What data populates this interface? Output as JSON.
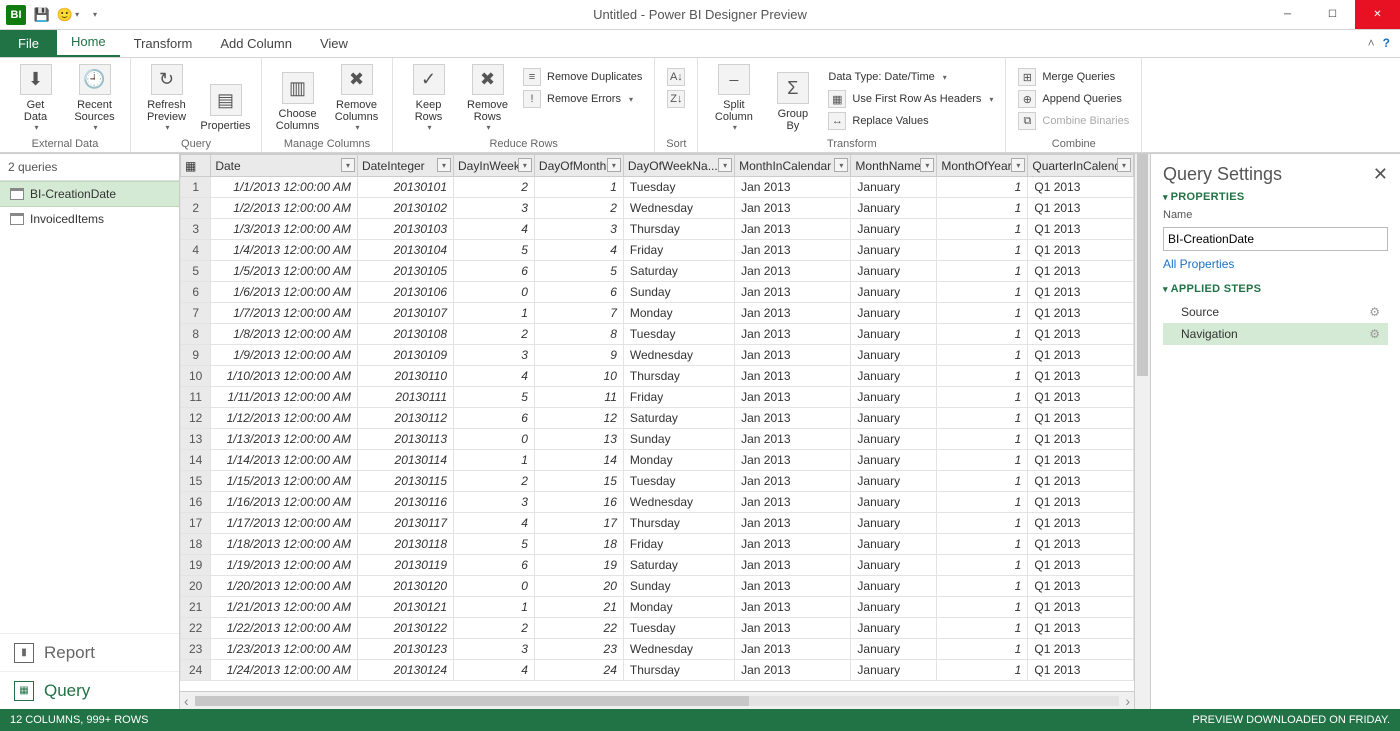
{
  "title": "Untitled - Power BI Designer Preview",
  "tabs": {
    "file": "File",
    "home": "Home",
    "transform": "Transform",
    "addcolumn": "Add Column",
    "view": "View"
  },
  "ribbon": {
    "external_data": {
      "label": "External Data",
      "get_data": "Get\nData",
      "recent_sources": "Recent\nSources"
    },
    "query": {
      "label": "Query",
      "refresh": "Refresh\nPreview",
      "properties": "Properties"
    },
    "manage_columns": {
      "label": "Manage Columns",
      "choose": "Choose\nColumns",
      "remove": "Remove\nColumns"
    },
    "reduce_rows": {
      "label": "Reduce Rows",
      "keep": "Keep\nRows",
      "remove": "Remove\nRows",
      "remove_dup": "Remove Duplicates",
      "remove_err": "Remove Errors"
    },
    "sort": {
      "label": "Sort"
    },
    "transform": {
      "label": "Transform",
      "split": "Split\nColumn",
      "group": "Group\nBy",
      "data_type": "Data Type: Date/Time",
      "first_row": "Use First Row As Headers",
      "replace": "Replace Values"
    },
    "combine": {
      "label": "Combine",
      "merge": "Merge Queries",
      "append": "Append Queries",
      "binaries": "Combine Binaries"
    }
  },
  "queries_panel": {
    "count_label": "2 queries",
    "items": [
      {
        "name": "BI-CreationDate",
        "selected": true
      },
      {
        "name": "InvoicedItems",
        "selected": false
      }
    ],
    "nav_report": "Report",
    "nav_query": "Query"
  },
  "columns": [
    {
      "key": "Date",
      "label": "Date",
      "cls": "col-date"
    },
    {
      "key": "DateInteger",
      "label": "DateInteger",
      "cls": "col-int"
    },
    {
      "key": "DayInWeek",
      "label": "DayInWeek",
      "cls": "col-diw"
    },
    {
      "key": "DayOfMonth",
      "label": "DayOfMonth",
      "cls": "col-dom"
    },
    {
      "key": "DayOfWeekName",
      "label": "DayOfWeekNa...",
      "cls": "col-down"
    },
    {
      "key": "MonthInCalendar",
      "label": "MonthInCalendar",
      "cls": "col-mic"
    },
    {
      "key": "MonthName",
      "label": "MonthName",
      "cls": "col-mname"
    },
    {
      "key": "MonthOfYear",
      "label": "MonthOfYear",
      "cls": "col-moy"
    },
    {
      "key": "QuarterInCalendar",
      "label": "QuarterInCalenda",
      "cls": "col-qic"
    }
  ],
  "rows": [
    {
      "n": 1,
      "Date": "1/1/2013 12:00:00 AM",
      "DateInteger": "20130101",
      "DayInWeek": "2",
      "DayOfMonth": "1",
      "DayOfWeekName": "Tuesday",
      "MonthInCalendar": "Jan 2013",
      "MonthName": "January",
      "MonthOfYear": "1",
      "QuarterInCalendar": "Q1 2013"
    },
    {
      "n": 2,
      "Date": "1/2/2013 12:00:00 AM",
      "DateInteger": "20130102",
      "DayInWeek": "3",
      "DayOfMonth": "2",
      "DayOfWeekName": "Wednesday",
      "MonthInCalendar": "Jan 2013",
      "MonthName": "January",
      "MonthOfYear": "1",
      "QuarterInCalendar": "Q1 2013"
    },
    {
      "n": 3,
      "Date": "1/3/2013 12:00:00 AM",
      "DateInteger": "20130103",
      "DayInWeek": "4",
      "DayOfMonth": "3",
      "DayOfWeekName": "Thursday",
      "MonthInCalendar": "Jan 2013",
      "MonthName": "January",
      "MonthOfYear": "1",
      "QuarterInCalendar": "Q1 2013"
    },
    {
      "n": 4,
      "Date": "1/4/2013 12:00:00 AM",
      "DateInteger": "20130104",
      "DayInWeek": "5",
      "DayOfMonth": "4",
      "DayOfWeekName": "Friday",
      "MonthInCalendar": "Jan 2013",
      "MonthName": "January",
      "MonthOfYear": "1",
      "QuarterInCalendar": "Q1 2013"
    },
    {
      "n": 5,
      "Date": "1/5/2013 12:00:00 AM",
      "DateInteger": "20130105",
      "DayInWeek": "6",
      "DayOfMonth": "5",
      "DayOfWeekName": "Saturday",
      "MonthInCalendar": "Jan 2013",
      "MonthName": "January",
      "MonthOfYear": "1",
      "QuarterInCalendar": "Q1 2013"
    },
    {
      "n": 6,
      "Date": "1/6/2013 12:00:00 AM",
      "DateInteger": "20130106",
      "DayInWeek": "0",
      "DayOfMonth": "6",
      "DayOfWeekName": "Sunday",
      "MonthInCalendar": "Jan 2013",
      "MonthName": "January",
      "MonthOfYear": "1",
      "QuarterInCalendar": "Q1 2013"
    },
    {
      "n": 7,
      "Date": "1/7/2013 12:00:00 AM",
      "DateInteger": "20130107",
      "DayInWeek": "1",
      "DayOfMonth": "7",
      "DayOfWeekName": "Monday",
      "MonthInCalendar": "Jan 2013",
      "MonthName": "January",
      "MonthOfYear": "1",
      "QuarterInCalendar": "Q1 2013"
    },
    {
      "n": 8,
      "Date": "1/8/2013 12:00:00 AM",
      "DateInteger": "20130108",
      "DayInWeek": "2",
      "DayOfMonth": "8",
      "DayOfWeekName": "Tuesday",
      "MonthInCalendar": "Jan 2013",
      "MonthName": "January",
      "MonthOfYear": "1",
      "QuarterInCalendar": "Q1 2013"
    },
    {
      "n": 9,
      "Date": "1/9/2013 12:00:00 AM",
      "DateInteger": "20130109",
      "DayInWeek": "3",
      "DayOfMonth": "9",
      "DayOfWeekName": "Wednesday",
      "MonthInCalendar": "Jan 2013",
      "MonthName": "January",
      "MonthOfYear": "1",
      "QuarterInCalendar": "Q1 2013"
    },
    {
      "n": 10,
      "Date": "1/10/2013 12:00:00 AM",
      "DateInteger": "20130110",
      "DayInWeek": "4",
      "DayOfMonth": "10",
      "DayOfWeekName": "Thursday",
      "MonthInCalendar": "Jan 2013",
      "MonthName": "January",
      "MonthOfYear": "1",
      "QuarterInCalendar": "Q1 2013"
    },
    {
      "n": 11,
      "Date": "1/11/2013 12:00:00 AM",
      "DateInteger": "20130111",
      "DayInWeek": "5",
      "DayOfMonth": "11",
      "DayOfWeekName": "Friday",
      "MonthInCalendar": "Jan 2013",
      "MonthName": "January",
      "MonthOfYear": "1",
      "QuarterInCalendar": "Q1 2013"
    },
    {
      "n": 12,
      "Date": "1/12/2013 12:00:00 AM",
      "DateInteger": "20130112",
      "DayInWeek": "6",
      "DayOfMonth": "12",
      "DayOfWeekName": "Saturday",
      "MonthInCalendar": "Jan 2013",
      "MonthName": "January",
      "MonthOfYear": "1",
      "QuarterInCalendar": "Q1 2013"
    },
    {
      "n": 13,
      "Date": "1/13/2013 12:00:00 AM",
      "DateInteger": "20130113",
      "DayInWeek": "0",
      "DayOfMonth": "13",
      "DayOfWeekName": "Sunday",
      "MonthInCalendar": "Jan 2013",
      "MonthName": "January",
      "MonthOfYear": "1",
      "QuarterInCalendar": "Q1 2013"
    },
    {
      "n": 14,
      "Date": "1/14/2013 12:00:00 AM",
      "DateInteger": "20130114",
      "DayInWeek": "1",
      "DayOfMonth": "14",
      "DayOfWeekName": "Monday",
      "MonthInCalendar": "Jan 2013",
      "MonthName": "January",
      "MonthOfYear": "1",
      "QuarterInCalendar": "Q1 2013"
    },
    {
      "n": 15,
      "Date": "1/15/2013 12:00:00 AM",
      "DateInteger": "20130115",
      "DayInWeek": "2",
      "DayOfMonth": "15",
      "DayOfWeekName": "Tuesday",
      "MonthInCalendar": "Jan 2013",
      "MonthName": "January",
      "MonthOfYear": "1",
      "QuarterInCalendar": "Q1 2013"
    },
    {
      "n": 16,
      "Date": "1/16/2013 12:00:00 AM",
      "DateInteger": "20130116",
      "DayInWeek": "3",
      "DayOfMonth": "16",
      "DayOfWeekName": "Wednesday",
      "MonthInCalendar": "Jan 2013",
      "MonthName": "January",
      "MonthOfYear": "1",
      "QuarterInCalendar": "Q1 2013"
    },
    {
      "n": 17,
      "Date": "1/17/2013 12:00:00 AM",
      "DateInteger": "20130117",
      "DayInWeek": "4",
      "DayOfMonth": "17",
      "DayOfWeekName": "Thursday",
      "MonthInCalendar": "Jan 2013",
      "MonthName": "January",
      "MonthOfYear": "1",
      "QuarterInCalendar": "Q1 2013"
    },
    {
      "n": 18,
      "Date": "1/18/2013 12:00:00 AM",
      "DateInteger": "20130118",
      "DayInWeek": "5",
      "DayOfMonth": "18",
      "DayOfWeekName": "Friday",
      "MonthInCalendar": "Jan 2013",
      "MonthName": "January",
      "MonthOfYear": "1",
      "QuarterInCalendar": "Q1 2013"
    },
    {
      "n": 19,
      "Date": "1/19/2013 12:00:00 AM",
      "DateInteger": "20130119",
      "DayInWeek": "6",
      "DayOfMonth": "19",
      "DayOfWeekName": "Saturday",
      "MonthInCalendar": "Jan 2013",
      "MonthName": "January",
      "MonthOfYear": "1",
      "QuarterInCalendar": "Q1 2013"
    },
    {
      "n": 20,
      "Date": "1/20/2013 12:00:00 AM",
      "DateInteger": "20130120",
      "DayInWeek": "0",
      "DayOfMonth": "20",
      "DayOfWeekName": "Sunday",
      "MonthInCalendar": "Jan 2013",
      "MonthName": "January",
      "MonthOfYear": "1",
      "QuarterInCalendar": "Q1 2013"
    },
    {
      "n": 21,
      "Date": "1/21/2013 12:00:00 AM",
      "DateInteger": "20130121",
      "DayInWeek": "1",
      "DayOfMonth": "21",
      "DayOfWeekName": "Monday",
      "MonthInCalendar": "Jan 2013",
      "MonthName": "January",
      "MonthOfYear": "1",
      "QuarterInCalendar": "Q1 2013"
    },
    {
      "n": 22,
      "Date": "1/22/2013 12:00:00 AM",
      "DateInteger": "20130122",
      "DayInWeek": "2",
      "DayOfMonth": "22",
      "DayOfWeekName": "Tuesday",
      "MonthInCalendar": "Jan 2013",
      "MonthName": "January",
      "MonthOfYear": "1",
      "QuarterInCalendar": "Q1 2013"
    },
    {
      "n": 23,
      "Date": "1/23/2013 12:00:00 AM",
      "DateInteger": "20130123",
      "DayInWeek": "3",
      "DayOfMonth": "23",
      "DayOfWeekName": "Wednesday",
      "MonthInCalendar": "Jan 2013",
      "MonthName": "January",
      "MonthOfYear": "1",
      "QuarterInCalendar": "Q1 2013"
    },
    {
      "n": 24,
      "Date": "1/24/2013 12:00:00 AM",
      "DateInteger": "20130124",
      "DayInWeek": "4",
      "DayOfMonth": "24",
      "DayOfWeekName": "Thursday",
      "MonthInCalendar": "Jan 2013",
      "MonthName": "January",
      "MonthOfYear": "1",
      "QuarterInCalendar": "Q1 2013"
    }
  ],
  "settings": {
    "title": "Query Settings",
    "properties_label": "PROPERTIES",
    "name_label": "Name",
    "name_value": "BI-CreationDate",
    "all_properties": "All Properties",
    "applied_steps_label": "APPLIED STEPS",
    "steps": [
      {
        "name": "Source",
        "selected": false
      },
      {
        "name": "Navigation",
        "selected": true
      }
    ]
  },
  "statusbar": {
    "left": "12 COLUMNS, 999+ ROWS",
    "right": "PREVIEW DOWNLOADED ON FRIDAY."
  }
}
